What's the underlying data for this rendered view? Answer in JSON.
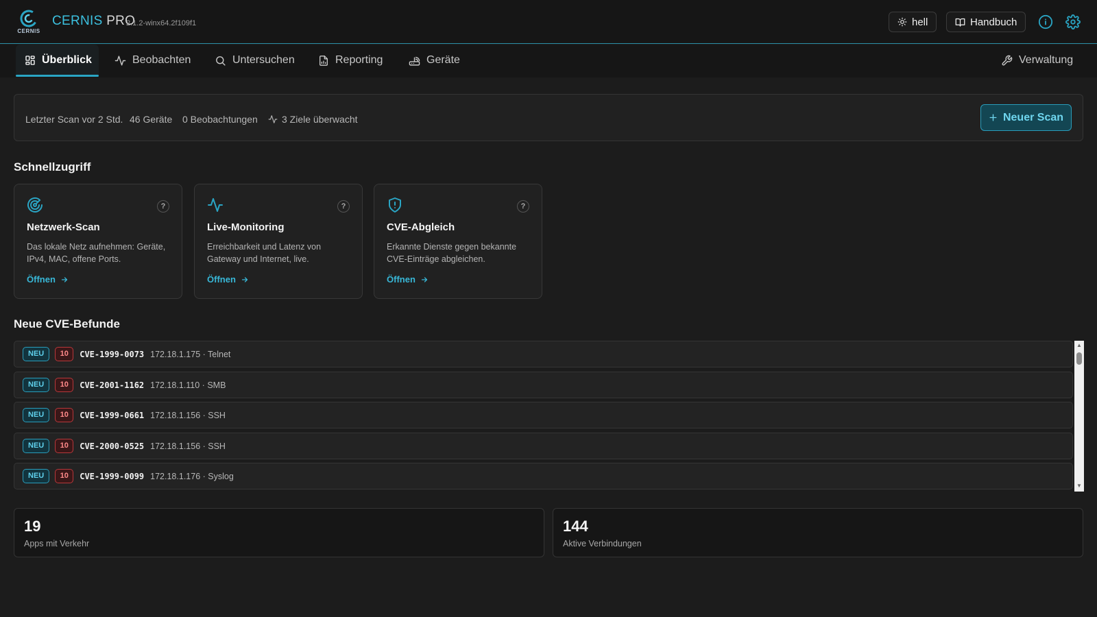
{
  "header": {
    "logo_text": "CERNIS",
    "app_name": "CERNIS",
    "app_edition": "PRO",
    "version": "2.1.2-winx64.2f109f1",
    "theme_label": "hell",
    "manual_label": "Handbuch"
  },
  "tabs": [
    {
      "label": "Überblick"
    },
    {
      "label": "Beobachten"
    },
    {
      "label": "Untersuchen"
    },
    {
      "label": "Reporting"
    },
    {
      "label": "Geräte"
    }
  ],
  "admin_tab": {
    "label": "Verwaltung"
  },
  "status": {
    "last_scan": "Letzter Scan vor 2 Std.",
    "devices": "46 Geräte",
    "observations": "0 Beobachtungen",
    "targets": "3 Ziele überwacht",
    "new_scan_label": "Neuer Scan"
  },
  "quick_access": {
    "title": "Schnellzugriff",
    "cards": [
      {
        "icon": "radar-icon",
        "title": "Netzwerk-Scan",
        "description": "Das lokale Netz aufnehmen: Geräte, IPv4, MAC, offene Ports.",
        "link": "Öffnen"
      },
      {
        "icon": "activity-icon",
        "title": "Live-Monitoring",
        "description": "Erreichbarkeit und Latenz von Gateway und Internet, live.",
        "link": "Öffnen"
      },
      {
        "icon": "shield-alert-icon",
        "title": "CVE-Abgleich",
        "description": "Erkannte Dienste gegen bekannte CVE-Einträge abgleichen.",
        "link": "Öffnen"
      }
    ],
    "help_glyph": "?"
  },
  "cve_findings": {
    "title": "Neue CVE-Befunde",
    "rows": [
      {
        "badge": "NEU",
        "score": "10",
        "id": "CVE-1999-0073",
        "host": "172.18.1.175 · Telnet"
      },
      {
        "badge": "NEU",
        "score": "10",
        "id": "CVE-2001-1162",
        "host": "172.18.1.110 · SMB"
      },
      {
        "badge": "NEU",
        "score": "10",
        "id": "CVE-1999-0661",
        "host": "172.18.1.156 · SSH"
      },
      {
        "badge": "NEU",
        "score": "10",
        "id": "CVE-2000-0525",
        "host": "172.18.1.156 · SSH"
      },
      {
        "badge": "NEU",
        "score": "10",
        "id": "CVE-1999-0099",
        "host": "172.18.1.176 · Syslog"
      }
    ]
  },
  "stats": [
    {
      "value": "19",
      "label": "Apps mit Verkehr"
    },
    {
      "value": "144",
      "label": "Aktive Verbindungen"
    }
  ],
  "colors": {
    "accent": "#2aa5c4",
    "severity": "#b8373a",
    "background": "#1c1c1c"
  }
}
